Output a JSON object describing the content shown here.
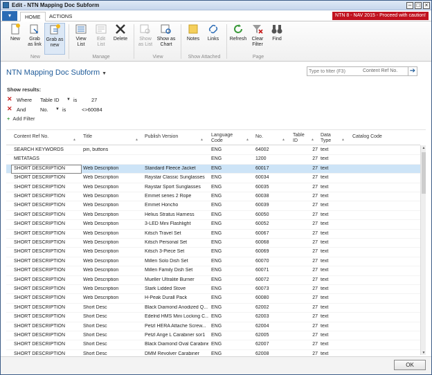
{
  "window": {
    "title": "Edit - NTN Mapping Doc Subform",
    "banner": "NTN 8 - NAV 2015 - Proceed with caution!"
  },
  "tabs": {
    "home": "HOME",
    "actions": "ACTIONS"
  },
  "ribbon": {
    "new": "New",
    "grab_as_link": [
      "Grab",
      "as link"
    ],
    "grab_as_new": [
      "Grab as",
      "new"
    ],
    "view_list": [
      "View",
      "List"
    ],
    "edit_list": [
      "Edit",
      "List"
    ],
    "delete": "Delete",
    "show_as_list": [
      "Show",
      "as List"
    ],
    "show_as_chart": [
      "Show as",
      "Chart"
    ],
    "notes": "Notes",
    "links": "Links",
    "refresh": "Refresh",
    "clear_filter": [
      "Clear",
      "Filter"
    ],
    "find": "Find",
    "groups": {
      "new": "New",
      "manage": "Manage",
      "view": "View",
      "show_attached": "Show Attached",
      "page": "Page"
    }
  },
  "page": {
    "title": "NTN Mapping Doc Subform",
    "filter_placeholder": "Type to filter (F3)",
    "filter_field": "Content Ref No."
  },
  "filters": {
    "show_results": "Show results:",
    "rows": [
      {
        "conj": "Where",
        "field": "Table ID",
        "op": "is",
        "value": "27"
      },
      {
        "conj": "And",
        "field": "No.",
        "op": "is",
        "value": "<>60084"
      }
    ],
    "add_filter": "Add Filter"
  },
  "columns": {
    "content_ref": "Content Ref No.",
    "title": "Title",
    "publish_version": "Publish Version",
    "language_code": [
      "Language",
      "Code"
    ],
    "no": "No.",
    "table_id": [
      "Table",
      "ID"
    ],
    "data_type": [
      "Data",
      "Type"
    ],
    "catalog_code": "Catalog Code"
  },
  "rows": [
    {
      "content_ref": "SEARCH KEYWORDS",
      "title": "pin, buttons",
      "publish_version": "",
      "lang": "ENG",
      "no": "64002",
      "table_id": "27",
      "data_type": "text"
    },
    {
      "content_ref": "METATAGS",
      "title": "",
      "publish_version": "",
      "lang": "ENG",
      "no": "1200",
      "table_id": "27",
      "data_type": "text"
    },
    {
      "content_ref": "SHORT DESCRIPTION",
      "title": "Web Description",
      "publish_version": "Standard Fleece Jacket",
      "lang": "ENG",
      "no": "60017",
      "table_id": "27",
      "data_type": "text"
    },
    {
      "content_ref": "SHORT DESCRIPTION",
      "title": "Web Description",
      "publish_version": "Raystar Classic Sunglasses",
      "lang": "ENG",
      "no": "60034",
      "table_id": "27",
      "data_type": "text"
    },
    {
      "content_ref": "SHORT DESCRIPTION",
      "title": "Web Description",
      "publish_version": "Raystar Sport Sunglasses",
      "lang": "ENG",
      "no": "60035",
      "table_id": "27",
      "data_type": "text"
    },
    {
      "content_ref": "SHORT DESCRIPTION",
      "title": "Web Description",
      "publish_version": "Emmet series 2 Rope",
      "lang": "ENG",
      "no": "60038",
      "table_id": "27",
      "data_type": "text"
    },
    {
      "content_ref": "SHORT DESCRIPTION",
      "title": "Web Description",
      "publish_version": "Emmet Honcho",
      "lang": "ENG",
      "no": "60039",
      "table_id": "27",
      "data_type": "text"
    },
    {
      "content_ref": "SHORT DESCRIPTION",
      "title": "Web Description",
      "publish_version": "Helius Stratus Harness",
      "lang": "ENG",
      "no": "60050",
      "table_id": "27",
      "data_type": "text"
    },
    {
      "content_ref": "SHORT DESCRIPTION",
      "title": "Web Description",
      "publish_version": "3-LED Mini Flashlight",
      "lang": "ENG",
      "no": "60052",
      "table_id": "27",
      "data_type": "text"
    },
    {
      "content_ref": "SHORT DESCRIPTION",
      "title": "Web Description",
      "publish_version": "Kitsch Travel Set",
      "lang": "ENG",
      "no": "60067",
      "table_id": "27",
      "data_type": "text"
    },
    {
      "content_ref": "SHORT DESCRIPTION",
      "title": "Web Description",
      "publish_version": "Kitsch Personal Set",
      "lang": "ENG",
      "no": "60068",
      "table_id": "27",
      "data_type": "text"
    },
    {
      "content_ref": "SHORT DESCRIPTION",
      "title": "Web Description",
      "publish_version": "Kitsch 3-Piece Set",
      "lang": "ENG",
      "no": "60069",
      "table_id": "27",
      "data_type": "text"
    },
    {
      "content_ref": "SHORT DESCRIPTION",
      "title": "Web Description",
      "publish_version": "Millen Solo Dish Set",
      "lang": "ENG",
      "no": "60070",
      "table_id": "27",
      "data_type": "text"
    },
    {
      "content_ref": "SHORT DESCRIPTION",
      "title": "Web Description",
      "publish_version": "Millen Family Dish Set",
      "lang": "ENG",
      "no": "60071",
      "table_id": "27",
      "data_type": "text"
    },
    {
      "content_ref": "SHORT DESCRIPTION",
      "title": "Web Description",
      "publish_version": "Mueller Ultralite Burner",
      "lang": "ENG",
      "no": "60072",
      "table_id": "27",
      "data_type": "text"
    },
    {
      "content_ref": "SHORT DESCRIPTION",
      "title": "Web Description",
      "publish_version": "Stark Lidded Stove",
      "lang": "ENG",
      "no": "60073",
      "table_id": "27",
      "data_type": "text"
    },
    {
      "content_ref": "SHORT DESCRIPTION",
      "title": "Web Description",
      "publish_version": "H-Peak Durall Pack",
      "lang": "ENG",
      "no": "60080",
      "table_id": "27",
      "data_type": "text"
    },
    {
      "content_ref": "SHORT DESCRIPTION",
      "title": "Short Desc",
      "publish_version": "Black Diamond Anodized Q...",
      "lang": "ENG",
      "no": "62002",
      "table_id": "27",
      "data_type": "text"
    },
    {
      "content_ref": "SHORT DESCRIPTION",
      "title": "Short Desc",
      "publish_version": "Edelrid HMS Mini Locking C...",
      "lang": "ENG",
      "no": "62003",
      "table_id": "27",
      "data_type": "text"
    },
    {
      "content_ref": "SHORT DESCRIPTION",
      "title": "Short Desc",
      "publish_version": "Petzl HERA Attache Screw...",
      "lang": "ENG",
      "no": "62004",
      "table_id": "27",
      "data_type": "text"
    },
    {
      "content_ref": "SHORT DESCRIPTION",
      "title": "Short Desc",
      "publish_version": "Petzl Ange L Carabiner sor1",
      "lang": "ENG",
      "no": "62005",
      "table_id": "27",
      "data_type": "text"
    },
    {
      "content_ref": "SHORT DESCRIPTION",
      "title": "Short Desc",
      "publish_version": "Black Diamond Oval Carabine",
      "lang": "ENG",
      "no": "62007",
      "table_id": "27",
      "data_type": "text"
    },
    {
      "content_ref": "SHORT DESCRIPTION",
      "title": "Short Desc",
      "publish_version": "DMM Revolver Carabiner",
      "lang": "ENG",
      "no": "62008",
      "table_id": "27",
      "data_type": "text"
    }
  ],
  "selected_row_index": 2,
  "footer": {
    "ok": "OK"
  }
}
